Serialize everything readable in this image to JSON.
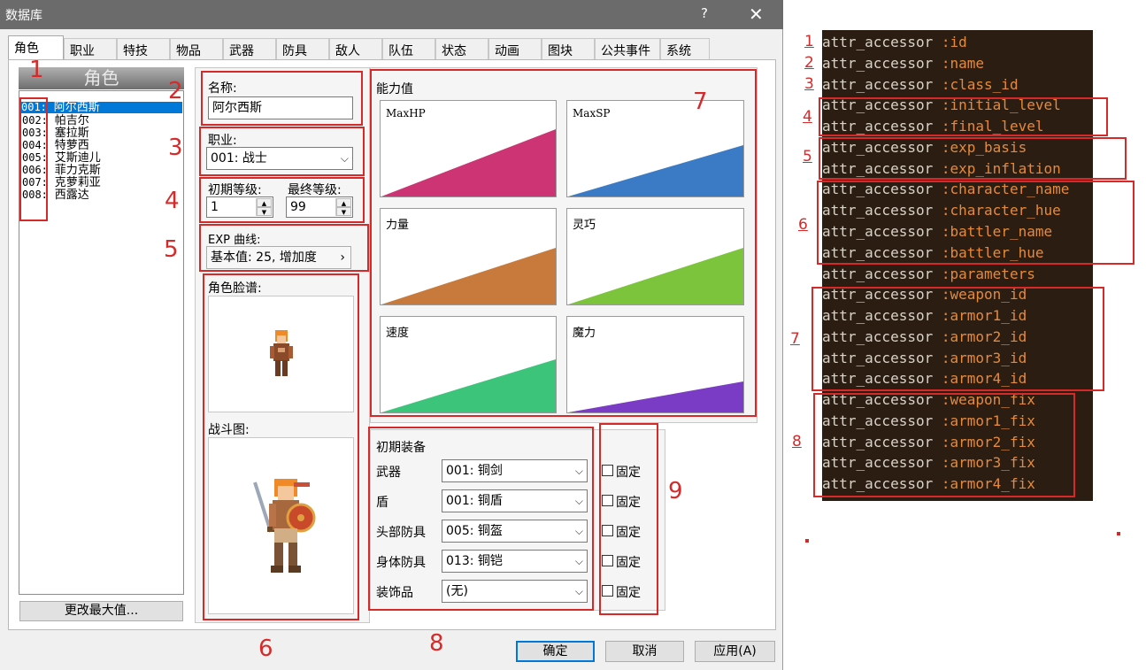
{
  "window": {
    "title": "数据库",
    "help_glyph": "?",
    "close_glyph": "✕"
  },
  "tabs": [
    "角色",
    "职业",
    "特技",
    "物品",
    "武器",
    "防具",
    "敌人",
    "队伍",
    "状态",
    "动画",
    "图块",
    "公共事件",
    "系统"
  ],
  "glyphs": {
    "chevron": "⌵",
    "up": "▲",
    "down": "▼",
    "right": "›"
  },
  "actor_list": {
    "header": "角色",
    "items": [
      {
        "id": "001:",
        "name": "阿尔西斯"
      },
      {
        "id": "002:",
        "name": "帕吉尔"
      },
      {
        "id": "003:",
        "name": "塞拉斯"
      },
      {
        "id": "004:",
        "name": "特萝西"
      },
      {
        "id": "005:",
        "name": "艾斯迪儿"
      },
      {
        "id": "006:",
        "name": "菲力克斯"
      },
      {
        "id": "007:",
        "name": "克萝莉亚"
      },
      {
        "id": "008:",
        "name": "西露达"
      }
    ],
    "change_max_label": "更改最大值..."
  },
  "form": {
    "name_label": "名称:",
    "name_value": "阿尔西斯",
    "class_label": "职业:",
    "class_value": "001: 战士",
    "initial_level_label": "初期等级:",
    "final_level_label": "最终等级:",
    "initial_level_value": "1",
    "final_level_value": "99",
    "exp_curve_label": "EXP 曲线:",
    "exp_curve_value": "基本值: 25, 增加度",
    "character_graphic_label": "角色脸谱:",
    "battler_graphic_label": "战斗图:"
  },
  "parameters": {
    "title": "能力值",
    "graphs": [
      {
        "label": "MaxHP",
        "color": "#cc3473"
      },
      {
        "label": "MaxSP",
        "color": "#3b7ac4"
      },
      {
        "label": "力量",
        "color": "#c87a3c"
      },
      {
        "label": "灵巧",
        "color": "#7cc43c"
      },
      {
        "label": "速度",
        "color": "#3cc47a"
      },
      {
        "label": "魔力",
        "color": "#7a3cc4"
      }
    ]
  },
  "equipment": {
    "title": "初期装备",
    "fix_label": "固定",
    "slots": [
      {
        "label": "武器",
        "value": "001: 铜剑"
      },
      {
        "label": "盾",
        "value": "001: 铜盾"
      },
      {
        "label": "头部防具",
        "value": "005: 铜盔"
      },
      {
        "label": "身体防具",
        "value": "013: 铜铠"
      },
      {
        "label": "装饰品",
        "value": "(无)"
      }
    ]
  },
  "dialog_buttons": {
    "ok": "确定",
    "cancel": "取消",
    "apply": "应用(A)"
  },
  "annotations": {
    "dialog": [
      "1",
      "2",
      "3",
      "4",
      "5",
      "6",
      "7",
      "8",
      "9"
    ],
    "code": [
      "1",
      "2",
      "3",
      "4",
      "5",
      "6",
      "7",
      "8"
    ]
  },
  "code": {
    "keyword": "attr_accessor",
    "symbols": [
      ":id",
      ":name",
      ":class_id",
      ":initial_level",
      ":final_level",
      ":exp_basis",
      ":exp_inflation",
      ":character_name",
      ":character_hue",
      ":battler_name",
      ":battler_hue",
      ":parameters",
      ":weapon_id",
      ":armor1_id",
      ":armor2_id",
      ":armor3_id",
      ":armor4_id",
      ":weapon_fix",
      ":armor1_fix",
      ":armor2_fix",
      ":armor3_fix",
      ":armor4_fix"
    ]
  },
  "colors": {
    "annotation_red": "#d62a2a",
    "code_background": "#2b1d12",
    "code_symbol": "#e58a3c",
    "selection_blue": "#0078d7"
  }
}
